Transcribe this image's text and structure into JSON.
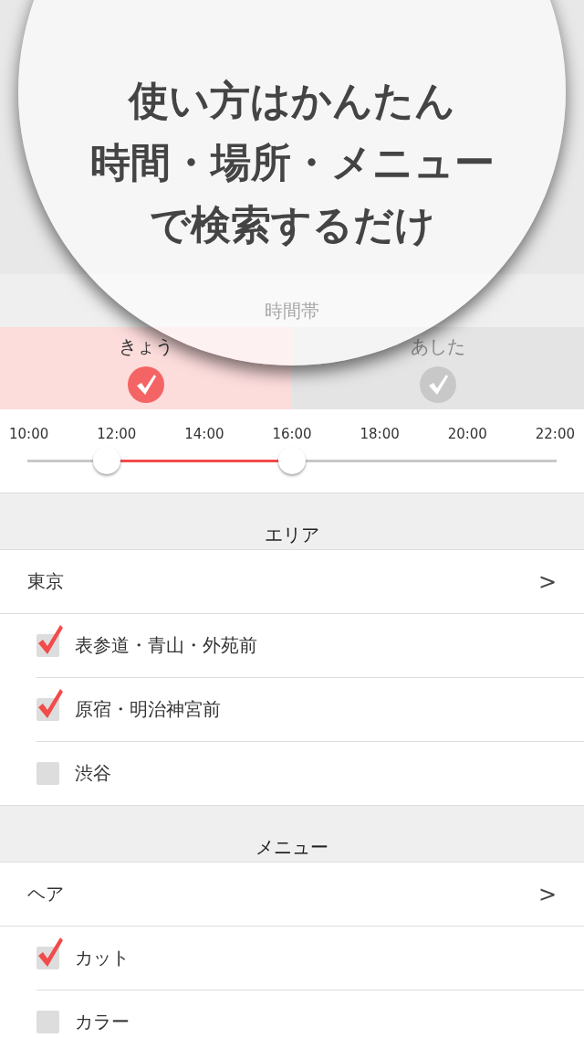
{
  "callout": {
    "lines": [
      "使い方はかんたん",
      "時間・場所・メニュー",
      "で検索するだけ"
    ]
  },
  "time_section": {
    "title": "時間帯",
    "days": [
      {
        "label": "きょう",
        "selected": true
      },
      {
        "label": "あした",
        "selected": false
      }
    ],
    "ticks": [
      "10:00",
      "12:00",
      "14:00",
      "16:00",
      "18:00",
      "20:00",
      "22:00"
    ],
    "thumbs": [
      {
        "level": 0.1667
      },
      {
        "level": 0.5
      }
    ]
  },
  "sections": [
    {
      "title": "エリア",
      "group": {
        "label": "東京",
        "chevron": ">"
      },
      "items": [
        {
          "label": "表参道・青山・外苑前",
          "checked": true
        },
        {
          "label": "原宿・明治神宮前",
          "checked": true
        },
        {
          "label": "渋谷",
          "checked": false
        }
      ]
    },
    {
      "title": "メニュー",
      "group": {
        "label": "ヘア",
        "chevron": ">"
      },
      "items": [
        {
          "label": "カット",
          "checked": true
        },
        {
          "label": "カラー",
          "checked": false
        }
      ]
    }
  ]
}
